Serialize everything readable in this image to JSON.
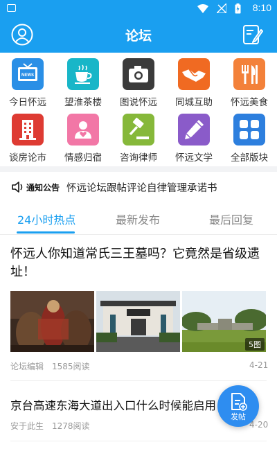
{
  "status_bar": {
    "time": "8:10",
    "icons": [
      "image-notification-icon",
      "wifi-icon",
      "no-signal-icon",
      "battery-charging-icon"
    ]
  },
  "header": {
    "title": "论坛",
    "left_icon": "user-avatar-icon",
    "right_icon": "edit-post-icon",
    "color": "#1a9ff0"
  },
  "categories": [
    {
      "label": "今日怀远",
      "icon": "tv-news-icon",
      "color": "#2a8fe6"
    },
    {
      "label": "望淮茶楼",
      "icon": "coffee-cup-icon",
      "color": "#18b6c8"
    },
    {
      "label": "图说怀远",
      "icon": "camera-icon",
      "color": "#3b3b3b"
    },
    {
      "label": "同城互助",
      "icon": "handshake-icon",
      "color": "#f06a22"
    },
    {
      "label": "怀远美食",
      "icon": "fork-knife-icon",
      "color": "#f3813a"
    },
    {
      "label": "谈房论市",
      "icon": "building-icon",
      "color": "#de3b33"
    },
    {
      "label": "情感归宿",
      "icon": "heart-person-icon",
      "color": "#f277a6"
    },
    {
      "label": "咨询律师",
      "icon": "gavel-icon",
      "color": "#86b83a"
    },
    {
      "label": "怀远文学",
      "icon": "pencil-icon",
      "color": "#8a5bc9"
    },
    {
      "label": "全部版块",
      "icon": "grid-icon",
      "color": "#2d7fde"
    }
  ],
  "notice": {
    "tag": "通知公告",
    "text": "怀远论坛跟帖评论自律管理承诺书"
  },
  "tabs": [
    {
      "label": "24小时热点",
      "active": true
    },
    {
      "label": "最新发布",
      "active": false
    },
    {
      "label": "最后回复",
      "active": false
    }
  ],
  "posts": [
    {
      "title": "怀远人你知道常氏三王墓吗？它竟然是省级遗址！",
      "author": "论坛编辑",
      "reads": "1585阅读",
      "date": "4-21",
      "image_count": "5图"
    },
    {
      "title": "京台高速东海大道出入口什么时候能启用",
      "author": "安于此生",
      "reads": "1278阅读",
      "date": "4-20"
    }
  ],
  "fab": {
    "label": "发帖",
    "icon": "post-document-icon"
  }
}
